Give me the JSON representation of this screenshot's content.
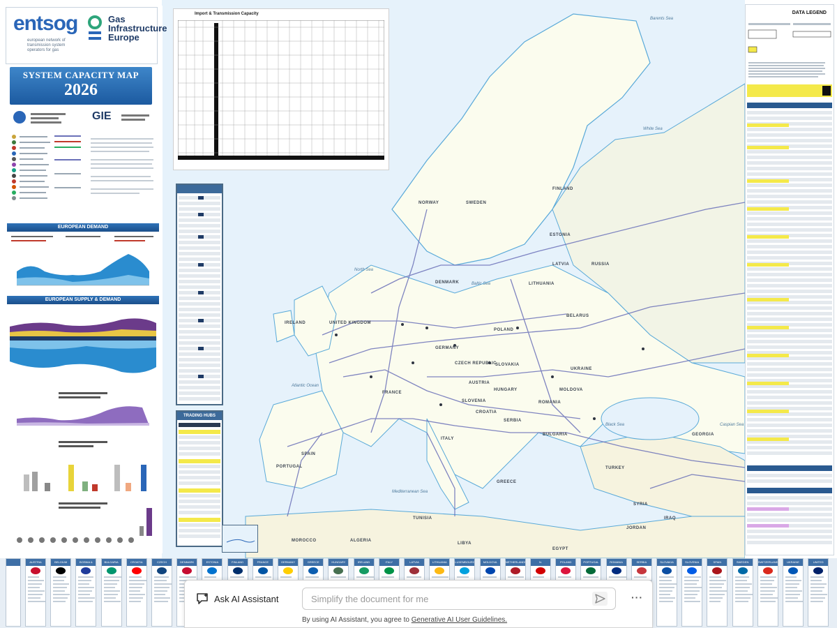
{
  "brand": {
    "entsog": "entsog",
    "entsog_sub": "european network of transmission system operators for gas",
    "gie": "Gas Infrastructure Europe",
    "gie_small": "GIE"
  },
  "title": {
    "line1": "SYSTEM CAPACITY MAP",
    "line2": "2026"
  },
  "sections": {
    "european_demand": "EUROPEAN DEMAND",
    "supply_demand": "EUROPEAN SUPPLY & DEMAND",
    "trading_hubs": "TRADING HUBS",
    "data_legend": "DATA LEGEND"
  },
  "cap_table": {
    "title": "Import & Transmission Capacity"
  },
  "map_labels": {
    "countries": [
      "NORWAY",
      "SWEDEN",
      "FINLAND",
      "ESTONIA",
      "LATVIA",
      "LITHUANIA",
      "BELARUS",
      "UKRAINE",
      "POLAND",
      "GERMANY",
      "DENMARK",
      "UNITED KINGDOM",
      "IRELAND",
      "FRANCE",
      "SPAIN",
      "PORTUGAL",
      "ITALY",
      "AUSTRIA",
      "SLOVAKIA",
      "HUNGARY",
      "ROMANIA",
      "BULGARIA",
      "GREECE",
      "TURKEY",
      "MOROCCO",
      "ALGERIA",
      "TUNISIA",
      "LIBYA",
      "EGYPT",
      "IRAQ",
      "SYRIA",
      "RUSSIA",
      "CZECH REPUBLIC",
      "SLOVENIA",
      "CROATIA",
      "SERBIA",
      "MOLDOVA",
      "JORDAN",
      "GEORGIA"
    ],
    "seas": [
      "Barents Sea",
      "North Sea",
      "Baltic Sea",
      "Atlantic Ocean",
      "Black Sea",
      "Mediterranean Sea",
      "Caspian Sea",
      "White Sea"
    ]
  },
  "countries": [
    "AUSTRIA",
    "BELGIUM",
    "BOSNIA & HERZ.",
    "BULGARIA",
    "CROATIA",
    "CZECH REPUBLIC",
    "DENMARK",
    "ESTONIA",
    "FINLAND",
    "FRANCE",
    "GERMANY",
    "GREECE",
    "HUNGARY",
    "IRELAND",
    "ITALY",
    "LATVIA",
    "LITHUANIA",
    "LUXEMBOURG",
    "MOLDOVA",
    "NETHERLANDS",
    "N. MACEDONIA",
    "POLAND",
    "PORTUGAL",
    "ROMANIA",
    "SERBIA",
    "SLOVAKIA",
    "SLOVENIA",
    "SPAIN",
    "SWEDEN",
    "SWITZERLAND",
    "UKRAINE",
    "UNITED KINGDOM"
  ],
  "ai": {
    "label": "Ask AI Assistant",
    "placeholder": "Simplify the document for me",
    "terms_prefix": "By using AI Assistant, you agree to ",
    "terms_link": "Generative AI User Guidelines."
  },
  "colors": {
    "brand_blue": "#2a66b8",
    "map_sea": "#e7f2fa",
    "land": "#fbfcee",
    "pipeline": "#6a70b8"
  }
}
